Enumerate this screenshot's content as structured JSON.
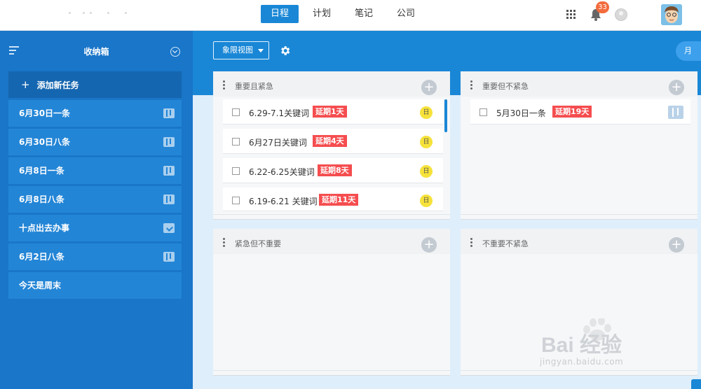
{
  "nav": {
    "tabs": [
      {
        "label": "日程",
        "active": true
      },
      {
        "label": "计划",
        "active": false
      },
      {
        "label": "笔记",
        "active": false
      },
      {
        "label": "公司",
        "active": false
      }
    ],
    "notification_count": "33"
  },
  "sidebar": {
    "title": "收纳箱",
    "add_task_label": "添加新任务",
    "items": [
      {
        "label": "6月30日一条",
        "icon": "board-icon"
      },
      {
        "label": "6月30日八条",
        "icon": "board-icon"
      },
      {
        "label": "6月8日一条",
        "icon": "board-icon"
      },
      {
        "label": "6月8日八条",
        "icon": "board-icon"
      },
      {
        "label": "十点出去办事",
        "icon": "inbox-download-icon"
      },
      {
        "label": "6月2日八条",
        "icon": "board-icon"
      },
      {
        "label": "今天是周末",
        "icon": ""
      }
    ]
  },
  "main": {
    "view_select": "象限视图",
    "month_button": "月",
    "quadrants": [
      {
        "title": "重要且紧急",
        "tasks": [
          {
            "text": "6.29-7.1关键词",
            "delay": "延期1天",
            "tag": "日"
          },
          {
            "text": "6月27日关键词",
            "delay": "延期4天",
            "tag": "日"
          },
          {
            "text": "6.22-6.25关键词",
            "delay": "延期8天",
            "tag": "日"
          },
          {
            "text": "6.19-6.21 关键词",
            "delay": "延期11天",
            "tag": "日"
          }
        ]
      },
      {
        "title": "重要但不紧急",
        "tasks": [
          {
            "text": "5月30日一条",
            "delay": "延期19天",
            "tag": ""
          }
        ]
      },
      {
        "title": "紧急但不重要",
        "tasks": []
      },
      {
        "title": "不重要不紧急",
        "tasks": []
      }
    ]
  },
  "colors": {
    "primary": "#1a87d6",
    "sidebar": "#1976c9",
    "delay_badge": "#f54d4f",
    "day_tag": "#f6e23a",
    "notification_badge": "#f36b3c"
  },
  "watermark": {
    "brand": "Bai 经验",
    "url": "jingyan.baidu.com"
  }
}
